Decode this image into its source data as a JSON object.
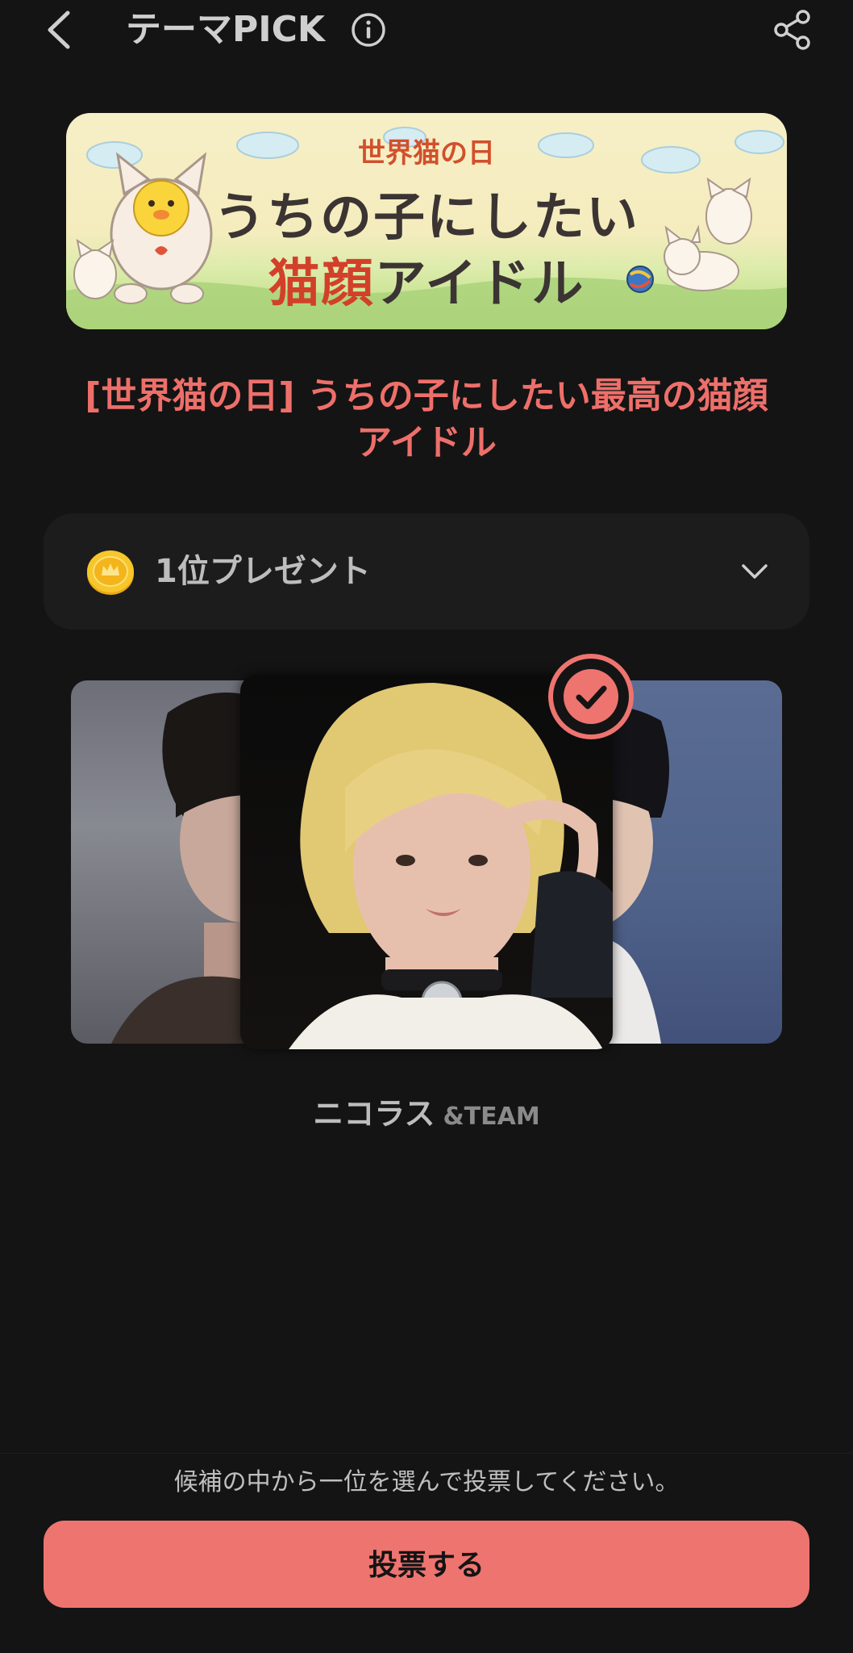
{
  "header": {
    "title": "テーマPICK"
  },
  "banner": {
    "subtitle": "世界猫の日",
    "line1": "うちの子にしたい",
    "line2_accent": "猫顔",
    "line2_rest": "アイドル"
  },
  "theme": {
    "title": "[世界猫の日] うちの子にしたい最高の猫顔 アイドル"
  },
  "prize": {
    "label": "1位プレゼント"
  },
  "candidate": {
    "name": "ニコラス",
    "group": "&TEAM"
  },
  "footer": {
    "instruction": "候補の中から一位を選んで投票してください。",
    "vote_label": "投票する"
  },
  "colors": {
    "accent": "#ee7470",
    "title": "#ee6f6a",
    "background": "#141414",
    "panel": "#1c1c1c"
  }
}
